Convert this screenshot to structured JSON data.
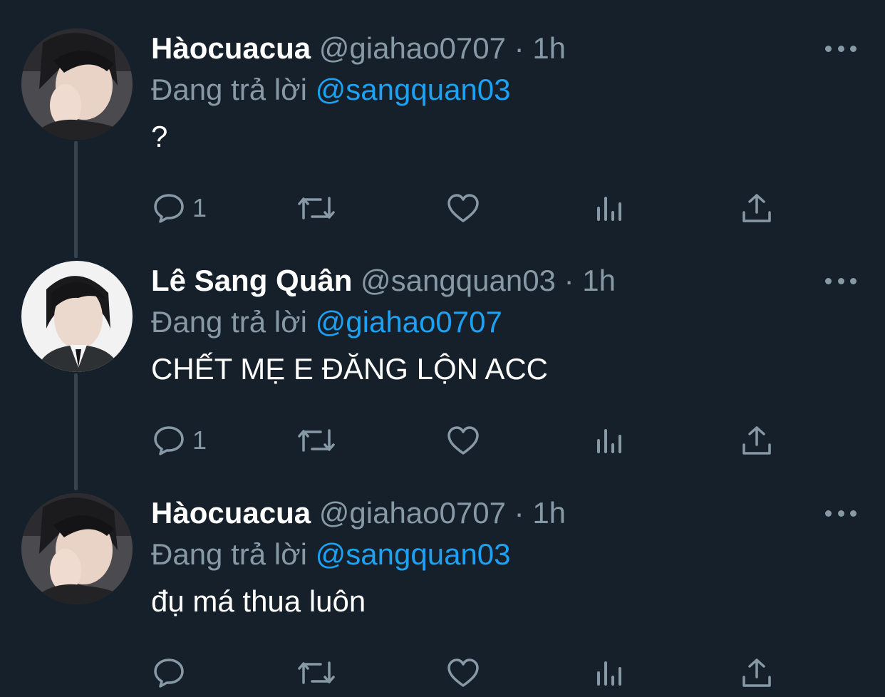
{
  "colors": {
    "background": "#15202b",
    "secondary_text": "#8899a6",
    "mention": "#1da1f2",
    "thread_line": "#38444d"
  },
  "tweets": [
    {
      "display_name": "Hàocuacua",
      "handle": "@giahao0707",
      "separator": "·",
      "time": "1h",
      "reply_prefix": "Đang trả lời",
      "reply_to": "@sangquan03",
      "text": "?",
      "reply_count": "1",
      "avatar": "avatar-photo-peace-sign"
    },
    {
      "display_name": "Lê Sang Quân",
      "handle": "@sangquan03",
      "separator": "·",
      "time": "1h",
      "reply_prefix": "Đang trả lời",
      "reply_to": "@giahao0707",
      "text": "CHẾT MẸ E ĐĂNG LỘN ACC",
      "reply_count": "1",
      "avatar": "avatar-photo-suit"
    },
    {
      "display_name": "Hàocuacua",
      "handle": "@giahao0707",
      "separator": "·",
      "time": "1h",
      "reply_prefix": "Đang trả lời",
      "reply_to": "@sangquan03",
      "text": "đụ má thua luôn",
      "reply_count": "",
      "avatar": "avatar-photo-peace-sign"
    }
  ],
  "action_icons": [
    "reply-icon",
    "retweet-icon",
    "like-icon",
    "analytics-icon",
    "share-icon"
  ]
}
